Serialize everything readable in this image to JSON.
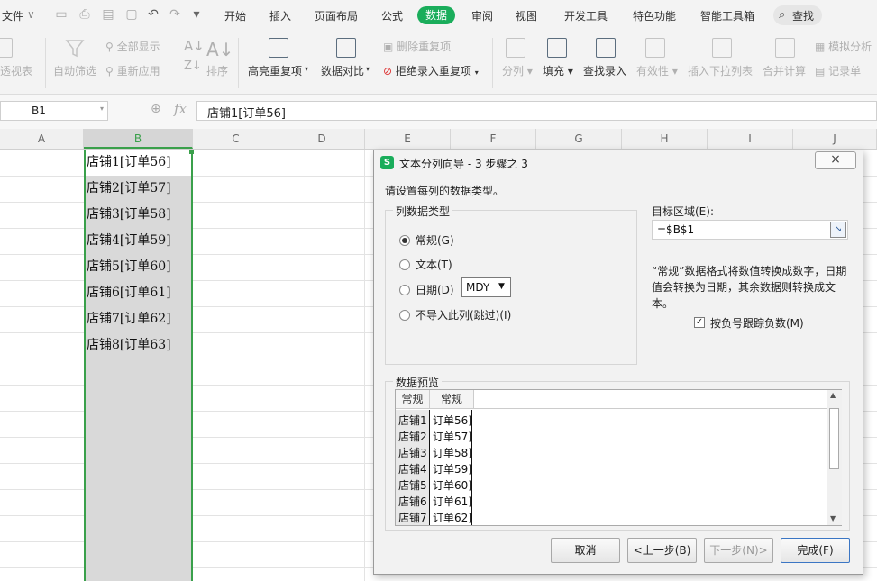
{
  "menubar": {
    "file": "文件",
    "tabs": [
      "开始",
      "插入",
      "页面布局",
      "公式",
      "数据",
      "审阅",
      "视图",
      "开发工具",
      "特色功能",
      "智能工具箱"
    ],
    "active_tab": "数据",
    "search": "查找"
  },
  "ribbon": {
    "pivot": "透视表",
    "auto_filter": "自动筛选",
    "show_all": "全部显示",
    "reapply": "重新应用",
    "sort": "排序",
    "highlight_dup": "高亮重复项",
    "compare": "数据对比",
    "remove_dup": "删除重复项",
    "reject_dup": "拒绝录入重复项",
    "split": "分列",
    "fill": "填充",
    "find_entry": "查找录入",
    "validity": "有效性",
    "dropdown": "插入下拉列表",
    "merge_calc": "合并计算",
    "simulate": "模拟分析",
    "record": "记录单"
  },
  "formula_bar": {
    "name_box": "B1",
    "fx": "fx",
    "content": "店铺1[订单56]"
  },
  "columns": [
    "A",
    "B",
    "C",
    "D",
    "E",
    "F",
    "G",
    "H",
    "I",
    "J"
  ],
  "cells": [
    "店铺1[订单56]",
    "店铺2[订单57]",
    "店铺3[订单58]",
    "店铺4[订单59]",
    "店铺5[订单60]",
    "店铺6[订单61]",
    "店铺7[订单62]",
    "店铺8[订单63]"
  ],
  "dialog": {
    "title": "文本分列向导 - 3 步骤之 3",
    "close": "×",
    "instruction": "请设置每列的数据类型。",
    "group_label": "列数据类型",
    "options": [
      "常规(G)",
      "文本(T)",
      "日期(D)",
      "不导入此列(跳过)(I)"
    ],
    "selected_option": "常规(G)",
    "date_format": "MDY",
    "target_label": "目标区域(E):",
    "target_value": "=$B$1",
    "hint": "“常规”数据格式将数值转换成数字，日期值会转换为日期，其余数据则转换成文本。",
    "negative_checkbox": "按负号跟踪负数(M)",
    "negative_checked": true,
    "preview_label": "数据预览",
    "preview_headers": [
      "常规",
      "常规"
    ],
    "preview_col1": [
      "店铺1",
      "店铺2",
      "店铺3",
      "店铺4",
      "店铺5",
      "店铺6",
      "店铺7"
    ],
    "preview_col2": [
      "订单56]",
      "订单57]",
      "订单58]",
      "订单59]",
      "订单60]",
      "订单61]",
      "订单62]"
    ],
    "buttons": {
      "cancel": "取消",
      "back": "<上一步(B)",
      "next": "下一步(N)>",
      "finish": "完成(F)"
    }
  },
  "colors": {
    "accent": "#1aad5b",
    "selection_border": "#3aa04b"
  }
}
